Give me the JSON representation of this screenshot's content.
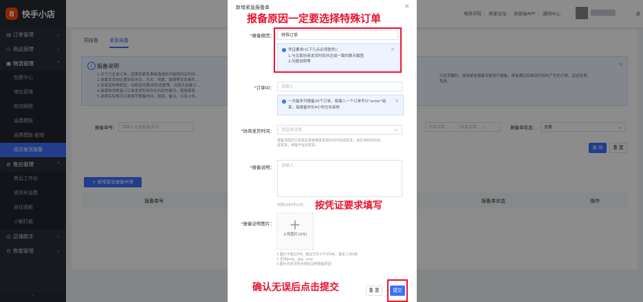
{
  "app": {
    "name": "快手小店",
    "logo_glyph": "ꟻ"
  },
  "topbar": {
    "links": [
      "电商学院",
      "商家论坛",
      "商家端APP",
      "通知中心"
    ],
    "logout": "退"
  },
  "sidebar": {
    "items": [
      {
        "label": "订单管理",
        "icon": "order-icon"
      },
      {
        "label": "商品管理",
        "icon": "goods-icon"
      },
      {
        "label": "物流管理",
        "icon": "logistics-icon"
      }
    ],
    "logistics_sub": [
      "包裹中心",
      "地址管理",
      "物流跟踪",
      "运费模板",
      "运费模板-新增",
      "延迟发货报备"
    ],
    "after_sale": {
      "label": "售后管理",
      "icon": "aftersale-icon"
    },
    "after_sale_sub": [
      "售后工作台",
      "退货补运费",
      "自动退款",
      "小额打款"
    ],
    "extra": [
      {
        "label": "店铺助手",
        "icon": "assistant-icon"
      },
      {
        "label": "数据管理",
        "icon": "data-icon"
      }
    ],
    "collapse_glyph": "‹"
  },
  "page": {
    "tabs": [
      "预报备",
      "紧急报备"
    ],
    "notice": {
      "title": "报备说明",
      "lines": [
        "1.对于已生成订单，因某些紧急事故造成的不能按约定时间…",
        "2.商家发货地区遭到如水灾、大灾、地震、疫情等突发事件…",
        "3.商家因特殊原因，如明显优惠/折扣设置等，出现大批量订…",
        "4.商家和消费者订订单发货时间存在约定的情况，使用紧急…",
        "5.请按实际情况以真填写报备时间，原因，备注，以及上传…"
      ],
      "right_lines": [
        "行发货履约，使用紧急报备功能进行报备，审批通过后相关时间内产生的订单，延迟免责。",
        "免责。"
      ]
    },
    "filters": {
      "order_label": "报备单号：",
      "order_placeholder": "请输入运输报备单号",
      "date_start": "开始日期",
      "date_sep": "-",
      "date_end": "结束日期",
      "status_label": "报备单状态：",
      "status_value": "全部"
    },
    "buttons": {
      "query": "查 询",
      "reset": "重 置",
      "new": "+ 新增紧急报备申请"
    },
    "table_headers": [
      "报备单号",
      "报备单状态",
      "操作"
    ]
  },
  "modal": {
    "title": "新增紧急报备单",
    "reason_label": "报备原因：",
    "reason_value": "特殊订单",
    "reason_tip": [
      "凭证要求(以下几点必须提供)：",
      "1.与买家协商发货时间并达成一致的聊天截图",
      "2.问题说明等"
    ],
    "order_label": "订单ID：",
    "order_placeholder": "请输入",
    "order_tip": [
      "一次最多可报备20个订单，每输入一个订单号以\"enter\"结",
      "束，每报备时长4小时左右审核"
    ],
    "time_label": "协商发货时间：",
    "time_placeholder": "请选择日期",
    "time_hint": [
      "报备范围内订单需在承诺维度发货时间内完成发货，请在该时间内完",
      "成发货，到履于延迟发货。"
    ],
    "desc_label": "报备说明：",
    "desc_placeholder": "请输入",
    "desc_limit": "仅限1000字以内",
    "proof_label": "报备证明图片：",
    "upload_label": "上传图片(0/5)",
    "upload_hints": [
      "1.图片不超过5M，建议文件小于200K，最多上传5张",
      "2.支持jpeg、jpg、png",
      "3.图片内容须包含相应证明报备原因"
    ],
    "reset": "重 置",
    "submit": "提交"
  },
  "annotations": {
    "top": "报备原因一定要选择特殊订单",
    "middle": "按凭证要求填写",
    "bottom": "确认无误后点击提交"
  },
  "colors": {
    "accent": "#3b72ff",
    "annotation": "#e8112d",
    "brand": "#ff4906"
  }
}
